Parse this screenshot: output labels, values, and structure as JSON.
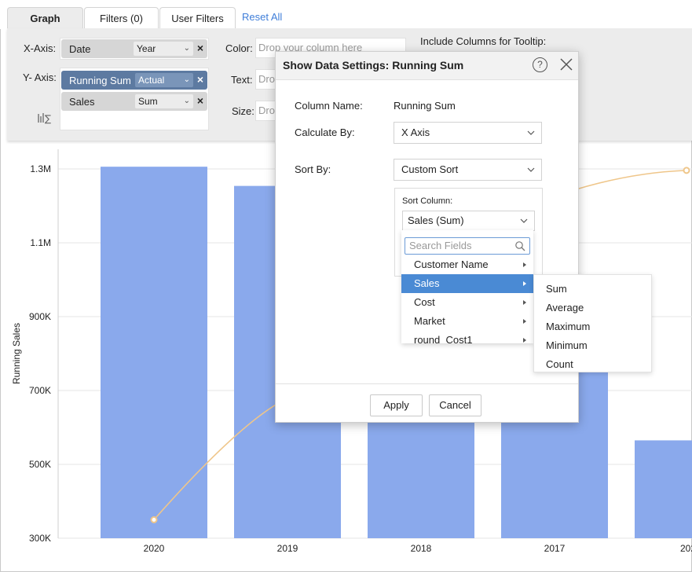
{
  "tabs": [
    {
      "label": "Graph"
    },
    {
      "label": "Filters  (0)"
    },
    {
      "label": "User Filters"
    }
  ],
  "reset_all": "Reset All",
  "shelves": {
    "x_axis_label": "X-Axis:",
    "y_axis_label": "Y- Axis:",
    "color_label": "Color:",
    "text_label": "Text:",
    "size_label": "Size:",
    "tooltip_label": "Include Columns for Tooltip:",
    "drop_placeholder": "Drop your column here",
    "text_drop_partial": "Dro",
    "size_drop_partial": "Dro",
    "x_pill": {
      "name": "Date",
      "agg": "Year"
    },
    "y_pills": [
      {
        "name": "Running Sum",
        "agg": "Actual"
      },
      {
        "name": "Sales",
        "agg": "Sum"
      }
    ]
  },
  "chart_data": {
    "type": "bar",
    "ylabel": "Running Sales",
    "categories": [
      "2020",
      "2019",
      "2018",
      "2017",
      "202"
    ],
    "values": [
      1306000,
      1254000,
      760000,
      755000,
      565000
    ],
    "line_values": [
      350000,
      null,
      null,
      null,
      1296000
    ],
    "yticks": [
      "1.3M",
      "1.1M",
      "900K",
      "700K",
      "500K",
      "300K"
    ],
    "ylim": [
      300000,
      1300000
    ],
    "bar_color": "#8aa9ec",
    "line_color": "#efc68a"
  },
  "modal": {
    "title": "Show Data Settings: Running Sum",
    "help": "?",
    "column_name_label": "Column Name:",
    "column_name_value": "Running Sum",
    "calculate_by_label": "Calculate By:",
    "calculate_by_value": "X Axis",
    "sort_by_label": "Sort By:",
    "sort_by_value": "Custom Sort",
    "sort_column_label": "Sort Column:",
    "sort_column_value": "Sales (Sum)",
    "apply": "Apply",
    "cancel": "Cancel"
  },
  "dropdown": {
    "search_placeholder": "Search Fields",
    "items": [
      "Customer Name",
      "Sales",
      "Cost",
      "Market",
      "round_Cost1"
    ],
    "selected": "Sales"
  },
  "submenu": {
    "items": [
      "Sum",
      "Average",
      "Maximum",
      "Minimum",
      "Count"
    ]
  }
}
